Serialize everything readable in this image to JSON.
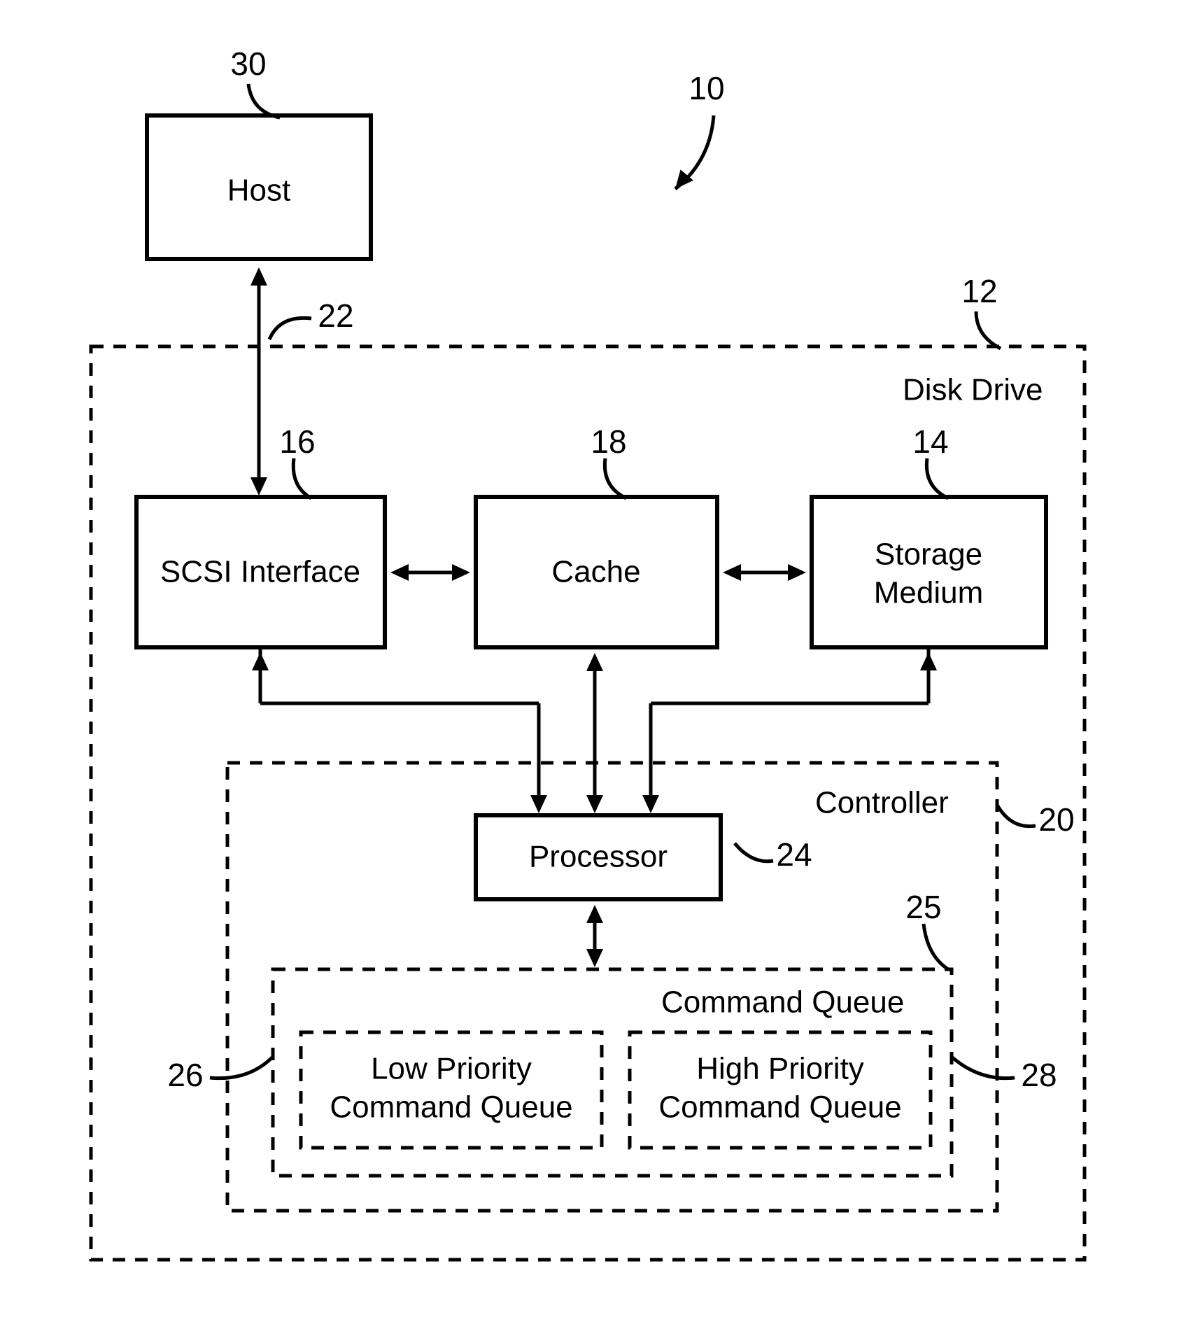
{
  "refs": {
    "host": "30",
    "system": "10",
    "diskDrive": "12",
    "hostBus": "22",
    "scsi": "16",
    "cache": "18",
    "storage": "14",
    "controller": "20",
    "processor": "24",
    "commandQueue": "25",
    "lowQ": "26",
    "highQ": "28"
  },
  "labels": {
    "host": "Host",
    "diskDrive": "Disk Drive",
    "scsi": "SCSI Interface",
    "cache": "Cache",
    "storageLine1": "Storage",
    "storageLine2": "Medium",
    "controller": "Controller",
    "processor": "Processor",
    "commandQueue": "Command Queue",
    "lowQLine1": "Low Priority",
    "lowQLine2": "Command Queue",
    "highQLine1": "High Priority",
    "highQLine2": "Command Queue"
  }
}
